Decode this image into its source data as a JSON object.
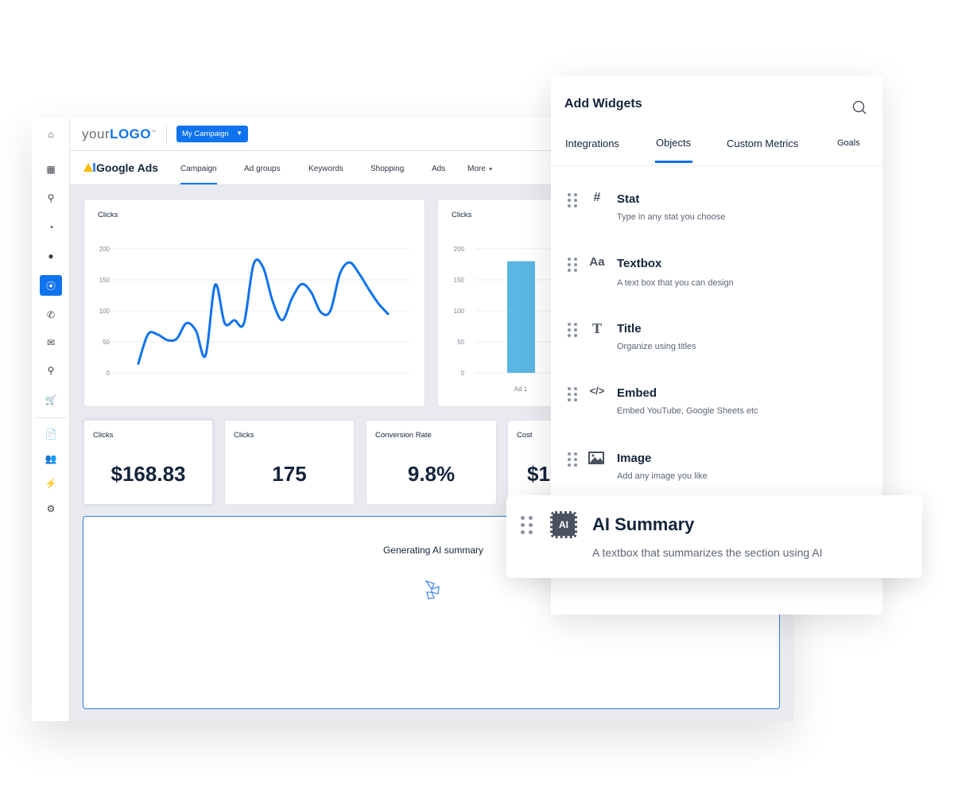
{
  "sidebar": {
    "icons": [
      "home-icon",
      "dashboard-icon",
      "search-icon",
      "pie-chart-icon",
      "chat-icon",
      "ppc-icon",
      "phone-icon",
      "mail-icon",
      "location-icon",
      "cart-icon",
      "document-icon",
      "users-icon",
      "plug-icon",
      "gear-icon"
    ],
    "active": "ppc-icon"
  },
  "header": {
    "logo_prefix": "your",
    "logo_main": "LOGO",
    "logo_tm": "™",
    "campaign_label": "My Campaign"
  },
  "nav": {
    "brand": "Google Ads",
    "items": [
      "Campaign",
      "Ad groups",
      "Keywords",
      "Shopping",
      "Ads",
      "More"
    ],
    "active": "Campaign"
  },
  "colors": {
    "accent": "#0f73ee",
    "bar": "#5bb6e2",
    "text": "#14243b"
  },
  "chart_data": [
    {
      "type": "line",
      "title": "Clicks",
      "ylim": [
        0,
        200
      ],
      "yticks": [
        0,
        50,
        100,
        150,
        200
      ],
      "grid": true,
      "x": [
        1,
        2,
        3,
        4,
        5,
        6,
        7,
        8,
        9,
        10,
        11,
        12,
        13,
        14,
        15,
        16,
        17,
        18,
        19,
        20,
        21,
        22,
        23,
        24,
        25,
        26,
        27
      ],
      "values": [
        15,
        62,
        62,
        53,
        55,
        80,
        68,
        28,
        142,
        80,
        85,
        80,
        175,
        170,
        115,
        85,
        120,
        143,
        130,
        98,
        100,
        160,
        178,
        160,
        135,
        112,
        95
      ]
    },
    {
      "type": "bar",
      "title": "Clicks",
      "ylim": [
        0,
        200
      ],
      "yticks": [
        0,
        50,
        100,
        150,
        200
      ],
      "grid": true,
      "categories": [
        "Ad 1"
      ],
      "values": [
        180
      ]
    }
  ],
  "stats": [
    {
      "label": "Clicks",
      "value": "$168.83"
    },
    {
      "label": "Clicks",
      "value": "175"
    },
    {
      "label": "Conversion Rate",
      "value": "9.8%"
    },
    {
      "label": "Cost",
      "value": "$1"
    }
  ],
  "ai_box": {
    "text": "Generating AI summary"
  },
  "panel": {
    "title": "Add Widgets",
    "tabs": [
      "Integrations",
      "Objects",
      "Custom Metrics",
      "Goals"
    ],
    "active_tab": "Objects",
    "items": [
      {
        "icon": "#",
        "name": "Stat",
        "desc": "Type in any stat you choose"
      },
      {
        "icon": "Aa",
        "name": "Textbox",
        "desc": "A text box that you can design"
      },
      {
        "icon": "T",
        "name": "Title",
        "desc": "Organize using titles"
      },
      {
        "icon": "</>",
        "name": "Embed",
        "desc": "Embed YouTube, Google Sheets etc"
      },
      {
        "icon": "image",
        "name": "Image",
        "desc": "Add any image you like"
      }
    ]
  },
  "ai_widget": {
    "icon": "AI",
    "name": "AI Summary",
    "desc": "A textbox that summarizes the section using AI"
  }
}
